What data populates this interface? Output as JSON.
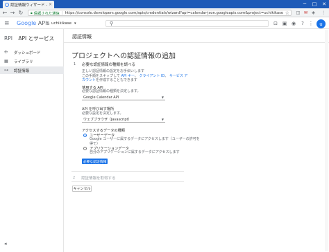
{
  "browser": {
    "tab_title": "認証情報ウィザード - uchiki",
    "window_controls": {
      "minimize": "─",
      "maximize": "□",
      "close": "✕"
    },
    "secure_label": "保護された通信",
    "url": "https://console.developers.google.com/apis/credentials/wizard?api=calendar-json.googleapis.com&project=uchikikase"
  },
  "header": {
    "logo_google": "Google",
    "logo_apis": "APIs",
    "project_name": "uchikikase",
    "avatar_initial": "u"
  },
  "sidebar": {
    "brand": "RPI",
    "title": "API とサービス",
    "items": [
      {
        "icon": "✣",
        "label": "ダッシュボード"
      },
      {
        "icon": "▦",
        "label": "ライブラリ"
      },
      {
        "icon": "⊶",
        "label": "認証情報"
      }
    ],
    "collapse_icon": "◂"
  },
  "page": {
    "header_title": "認証情報",
    "main_title": "プロジェクトへの認証情報の追加"
  },
  "step1": {
    "number": "1",
    "title": "必要な認証情報の種類を調べる",
    "desc_line1": "正しい認証情報の設定をお手伝いします",
    "desc_line2_pre": "この手順をスキップして",
    "desc_link1": "API キー",
    "desc_comma": "、",
    "desc_link2": "クライアント ID",
    "desc_and": "、",
    "desc_link3": "サービス ア",
    "desc_line3_link": "カウント",
    "desc_line3_post": "を作成することもできます",
    "api_heading": "使用する API",
    "api_caption": "必要な認証情報の種類を決定します。",
    "api_select": "Google Calendar API",
    "caller_heading": "API を呼び出す場所",
    "caller_caption": "必要な設定を決定します。",
    "caller_select": "ウェブブラウザ（Javascript）",
    "data_heading": "アクセスするデータの種類",
    "radio1_label": "ユーザーデータ",
    "radio1_desc_a": "Google ユーザーに属するデータにアクセスします（ユーザーの許可を",
    "radio1_desc_b": "得て）",
    "radio2_label": "アプリケーションデータ",
    "radio2_desc": "自分のアプリケーションに属するデータにアクセスします",
    "next_button": "必要な認証情報"
  },
  "step2": {
    "number": "2",
    "title": "認証情報を取得する"
  },
  "cancel_button": "キャンセル"
}
